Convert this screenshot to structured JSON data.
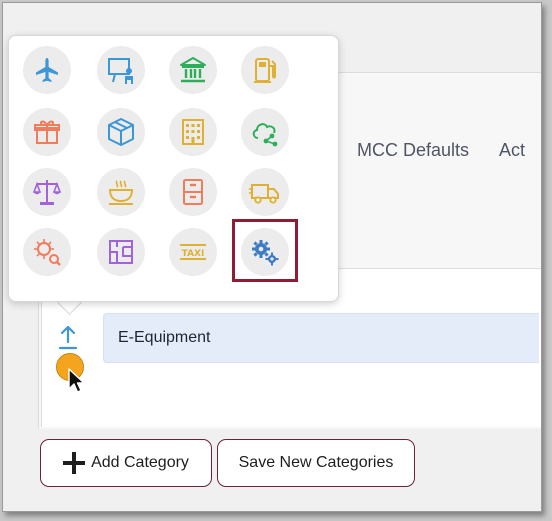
{
  "tabs": [
    {
      "label": "MCC Defaults"
    },
    {
      "label": "Act"
    }
  ],
  "category_row": {
    "name_value": "E-Equipment"
  },
  "buttons": {
    "add_category": "Add Category",
    "save_new_categories": "Save New Categories"
  },
  "icon_picker": {
    "icons": [
      {
        "name": "airplane-icon",
        "color": "#3d96d6"
      },
      {
        "name": "presentation-icon",
        "color": "#3d96d6"
      },
      {
        "name": "bank-icon",
        "color": "#2fae5a"
      },
      {
        "name": "fuel-pump-icon",
        "color": "#e0b032"
      },
      {
        "name": "gift-icon",
        "color": "#f07c5c"
      },
      {
        "name": "package-box-icon",
        "color": "#3d96d6"
      },
      {
        "name": "building-icon",
        "color": "#e0b032"
      },
      {
        "name": "cloud-share-icon",
        "color": "#2fae5a"
      },
      {
        "name": "balance-scale-icon",
        "color": "#a064d8"
      },
      {
        "name": "coffee-cup-icon",
        "color": "#e0b032"
      },
      {
        "name": "filing-cabinet-icon",
        "color": "#f07c5c"
      },
      {
        "name": "delivery-truck-icon",
        "color": "#e0b032"
      },
      {
        "name": "virus-search-icon",
        "color": "#f07c5c"
      },
      {
        "name": "floor-plan-icon",
        "color": "#a064d8"
      },
      {
        "name": "taxi-sign-icon",
        "color": "#e0b032"
      },
      {
        "name": "gears-icon",
        "color": "#3d7cc4"
      }
    ],
    "selected_icon": "gears-icon",
    "highlight_color": "#8f1c35"
  },
  "colors": {
    "accent_border": "#6b2236",
    "input_background": "#e3ecf8",
    "upload_icon": "#3d96d6"
  }
}
